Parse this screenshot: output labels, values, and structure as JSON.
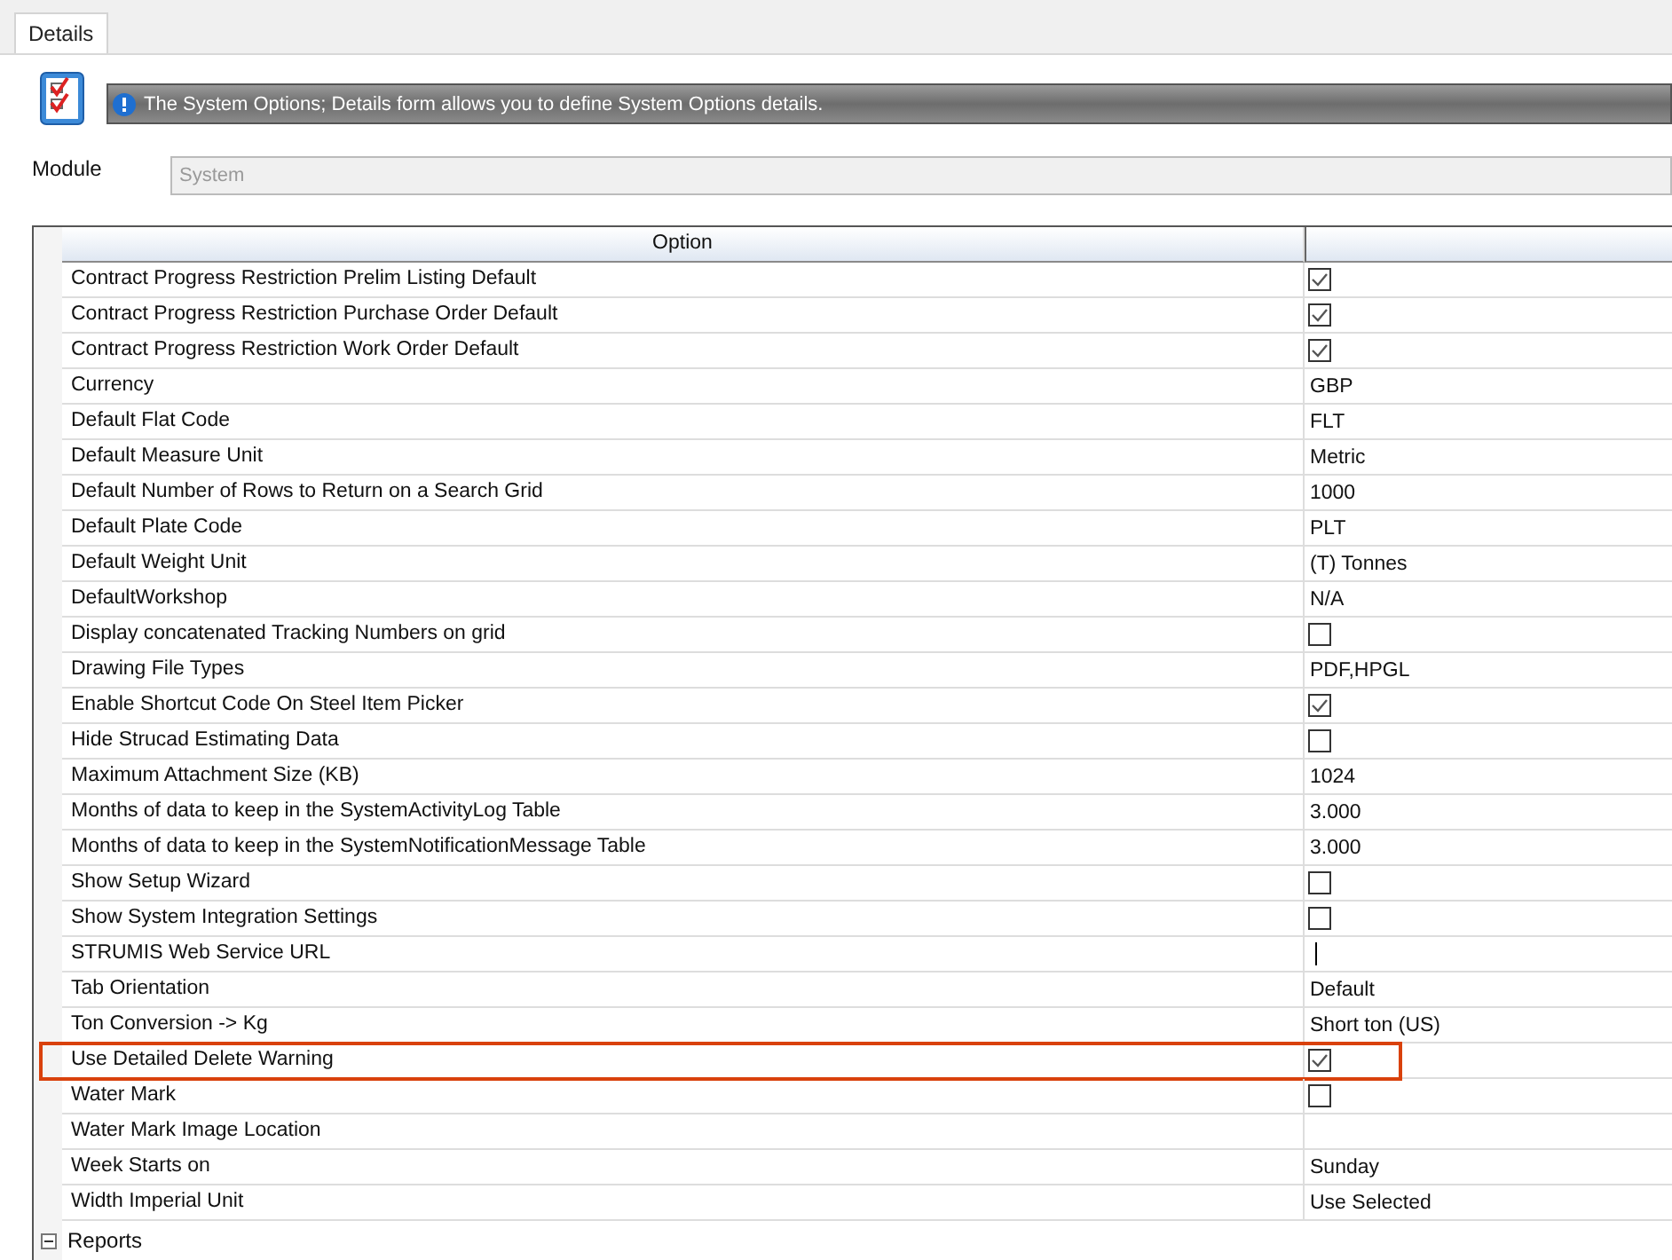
{
  "tabs": [
    {
      "label": "Details",
      "selected": true
    }
  ],
  "info_banner": {
    "text": "The System Options; Details form allows you to define System Options details."
  },
  "module": {
    "label": "Module",
    "value": "System",
    "disabled": true
  },
  "grid": {
    "columns": [
      "Option"
    ],
    "rows": [
      {
        "option": "Contract Progress Restriction Prelim Listing Default",
        "kind": "check",
        "checked": true,
        "highlighted": false
      },
      {
        "option": "Contract Progress Restriction Purchase Order Default",
        "kind": "check",
        "checked": true,
        "highlighted": false
      },
      {
        "option": "Contract Progress Restriction Work Order Default",
        "kind": "check",
        "checked": true,
        "highlighted": false
      },
      {
        "option": "Currency",
        "kind": "text",
        "value": "GBP",
        "highlighted": false
      },
      {
        "option": "Default Flat Code",
        "kind": "text",
        "value": "FLT",
        "highlighted": false
      },
      {
        "option": "Default Measure Unit",
        "kind": "text",
        "value": "Metric",
        "highlighted": false
      },
      {
        "option": "Default Number of Rows to Return on a Search Grid",
        "kind": "text",
        "value": "1000",
        "highlighted": false
      },
      {
        "option": "Default Plate Code",
        "kind": "text",
        "value": "PLT",
        "highlighted": false
      },
      {
        "option": "Default Weight Unit",
        "kind": "text",
        "value": "(T) Tonnes",
        "highlighted": false
      },
      {
        "option": "DefaultWorkshop",
        "kind": "text",
        "value": "N/A",
        "highlighted": false
      },
      {
        "option": "Display concatenated Tracking Numbers on grid",
        "kind": "check",
        "checked": false,
        "highlighted": false
      },
      {
        "option": "Drawing File Types",
        "kind": "text",
        "value": "PDF,HPGL",
        "highlighted": false
      },
      {
        "option": "Enable Shortcut Code On Steel Item Picker",
        "kind": "check",
        "checked": true,
        "highlighted": false
      },
      {
        "option": "Hide Strucad Estimating Data",
        "kind": "check",
        "checked": false,
        "highlighted": false
      },
      {
        "option": "Maximum Attachment Size (KB)",
        "kind": "text",
        "value": "1024",
        "highlighted": false
      },
      {
        "option": "Months of data to keep in the SystemActivityLog Table",
        "kind": "text",
        "value": "3.000",
        "highlighted": false
      },
      {
        "option": "Months of data to keep in the SystemNotificationMessage Table",
        "kind": "text",
        "value": "3.000",
        "highlighted": false
      },
      {
        "option": "Show Setup Wizard",
        "kind": "check",
        "checked": false,
        "highlighted": false
      },
      {
        "option": "Show System Integration Settings",
        "kind": "check",
        "checked": false,
        "highlighted": false
      },
      {
        "option": "STRUMIS Web Service URL",
        "kind": "editing",
        "highlighted": false
      },
      {
        "option": "Tab Orientation",
        "kind": "text",
        "value": "Default",
        "highlighted": false
      },
      {
        "option": "Ton Conversion -> Kg",
        "kind": "text",
        "value": "Short ton (US)",
        "highlighted": false
      },
      {
        "option": "Use Detailed Delete Warning",
        "kind": "check",
        "checked": true,
        "highlighted": true
      },
      {
        "option": "Water Mark",
        "kind": "check",
        "checked": false,
        "highlighted": false
      },
      {
        "option": "Water Mark Image Location",
        "kind": "empty",
        "highlighted": false
      },
      {
        "option": "Week Starts on",
        "kind": "text",
        "value": "Sunday",
        "highlighted": false
      },
      {
        "option": "Width Imperial Unit",
        "kind": "text",
        "value": "Use Selected",
        "highlighted": false
      }
    ],
    "group": {
      "label": "Reports",
      "expanded": true
    }
  }
}
